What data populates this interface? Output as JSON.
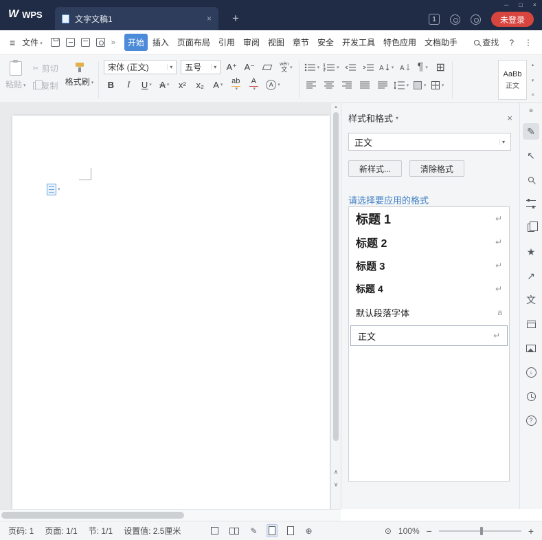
{
  "titlebar": {
    "logo_text": "WPS",
    "tab_title": "文字文稿1",
    "badge": "1",
    "login_label": "未登录"
  },
  "menubar": {
    "file_label": "文件",
    "tabs": [
      {
        "label": "开始"
      },
      {
        "label": "插入"
      },
      {
        "label": "页面布局"
      },
      {
        "label": "引用"
      },
      {
        "label": "审阅"
      },
      {
        "label": "视图"
      },
      {
        "label": "章节"
      },
      {
        "label": "安全"
      },
      {
        "label": "开发工具"
      },
      {
        "label": "特色应用"
      },
      {
        "label": "文档助手"
      }
    ],
    "find_label": "查找"
  },
  "ribbon": {
    "paste_label": "粘贴",
    "cut_label": "剪切",
    "copy_label": "复制",
    "format_painter_label": "格式刷",
    "font_name": "宋体 (正文)",
    "font_size": "五号",
    "grow_font": "A⁺",
    "shrink_font": "A⁻",
    "pinyin_top": "wén",
    "pinyin_bottom": "文",
    "bold": "B",
    "italic": "I",
    "underline": "U",
    "strike": "A",
    "superscript": "x²",
    "subscript": "x₂",
    "text_effect": "A",
    "highlight": "ab",
    "font_color": "A",
    "char_shading": "A",
    "style_sample": "AaBb",
    "style_name": "正文"
  },
  "task_pane": {
    "title": "样式和格式",
    "style_selector": "正文",
    "new_style_label": "新样式...",
    "clear_format_label": "清除格式",
    "hint": "请选择要应用的格式",
    "styles": [
      {
        "label": "标题 1",
        "mark": "↵"
      },
      {
        "label": "标题 2",
        "mark": "↵"
      },
      {
        "label": "标题 3",
        "mark": "↵"
      },
      {
        "label": "标题 4",
        "mark": "↵"
      },
      {
        "label": "默认段落字体",
        "mark": "a"
      },
      {
        "label": "正文",
        "mark": "↵"
      }
    ]
  },
  "statusbar": {
    "page_number": "页码: 1",
    "page_count": "页面: 1/1",
    "section": "节: 1/1",
    "margin_setting": "设置值: 2.5厘米",
    "zoom_level": "100%"
  },
  "colors": {
    "titlebar_bg": "#202b45",
    "active_tab_bg": "#4c8bd9",
    "login_red": "#d8453f",
    "hint_blue": "#3f7fc4"
  },
  "icons": {
    "wps_logo": "W",
    "close": "×",
    "minimize": "─",
    "maximize": "□",
    "plus": "+",
    "hamburger": "≡",
    "overflow_chevrons": "»",
    "more": "⋮",
    "help": "?",
    "caret": "▾",
    "scissors": "✂",
    "up_arrow": "▴",
    "page_up": "∧",
    "page_down": "∨",
    "star": "★",
    "pen": "✎",
    "cursor": "↖",
    "share": "↗",
    "translate": "文",
    "down": "↓",
    "globe": "⊕",
    "eye": "⊙",
    "minus": "−",
    "pilcrow": "¶",
    "grid": "⊞"
  }
}
